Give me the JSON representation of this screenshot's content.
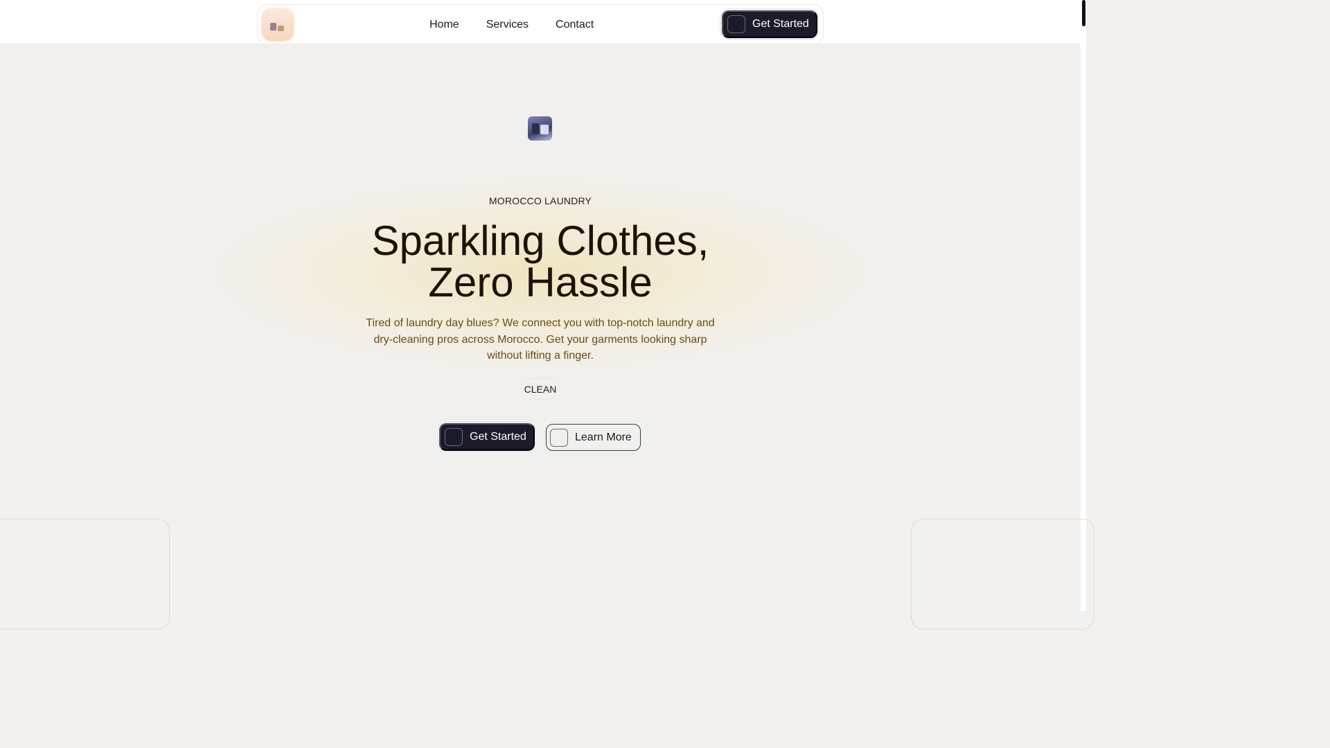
{
  "nav": {
    "links": [
      "Home",
      "Services",
      "Contact"
    ],
    "cta_label": "Get Started",
    "cta_icon": "arrow-icon"
  },
  "hero": {
    "eyebrow": "MOROCCO LAUNDRY",
    "headline_line1": "Sparkling Clothes,",
    "headline_line2": "Zero Hassle",
    "subtext": "Tired of laundry day blues? We connect you with top-notch laundry and dry-cleaning pros across Morocco. Get your garments looking sharp without lifting a finger.",
    "chip": "CLEAN",
    "primary_button": "Get Started",
    "secondary_button": "Learn More"
  },
  "colors": {
    "background": "#f1f0ee",
    "button_dark": "#1c1b29",
    "subtext": "#6e4a14",
    "glow": "#f0e2b2"
  }
}
